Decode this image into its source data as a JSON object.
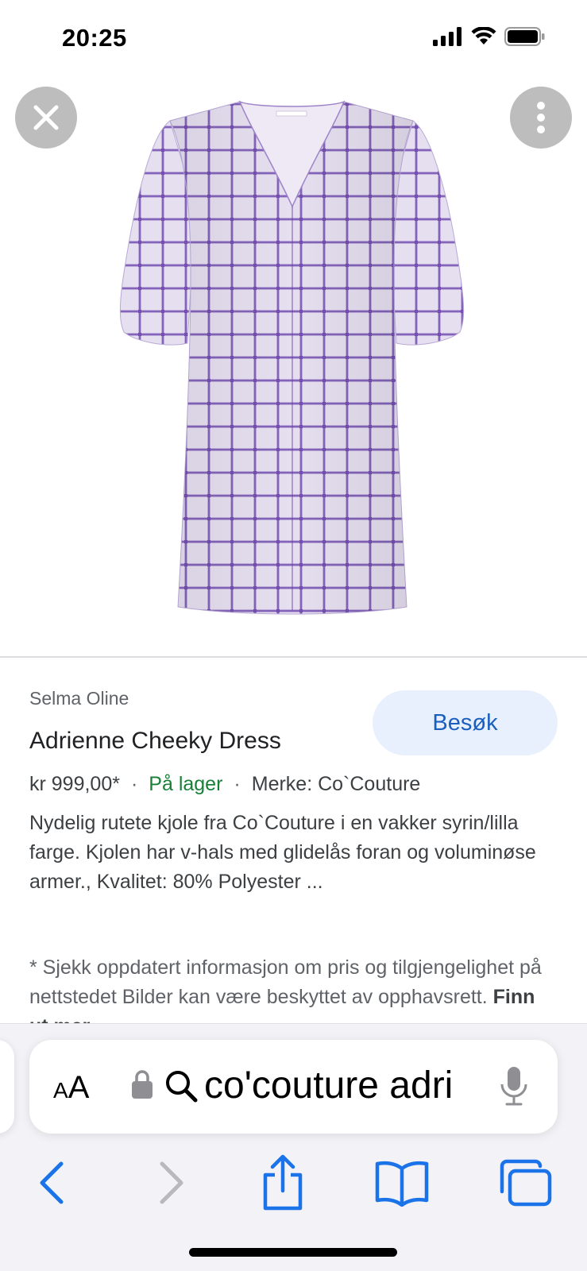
{
  "status_bar": {
    "time": "20:25"
  },
  "viewer": {
    "close_icon": "close-icon",
    "more_icon": "more-vertical-icon",
    "image": "purple-gingham-dress",
    "colors": {
      "fabric": "#e4dcef",
      "check": "#7b55b4"
    }
  },
  "product": {
    "site": "Selma Oline",
    "visit_label": "Besøk",
    "title": "Adrienne Cheeky Dress",
    "price": "kr 999,00*",
    "stock": "På lager",
    "brand": "Merke: Co`Couture",
    "description": "Nydelig rutete kjole fra Co`Couture i en vakker syrin/lilla farge. Kjolen har v-hals med glidelås foran og voluminøse armer., Kvalitet: 80% Polyester ...",
    "disclaimer": "* Sjekk oppdatert informasjon om pris og tilgjengelighet på nettstedet Bilder kan være beskyttet av opphavsrett.",
    "disclaimer_link": "Finn ut mer"
  },
  "safari": {
    "aa_small": "A",
    "aa_big": "A",
    "url": "co'couture adri",
    "icons": [
      "lock-icon",
      "search-icon",
      "mic-icon",
      "back-icon",
      "forward-icon",
      "share-icon",
      "bookmarks-icon",
      "tabs-icon"
    ]
  },
  "colors": {
    "accent": "#1a73e8",
    "visit_bg": "#e8f0fe",
    "stock_green": "#188038"
  }
}
